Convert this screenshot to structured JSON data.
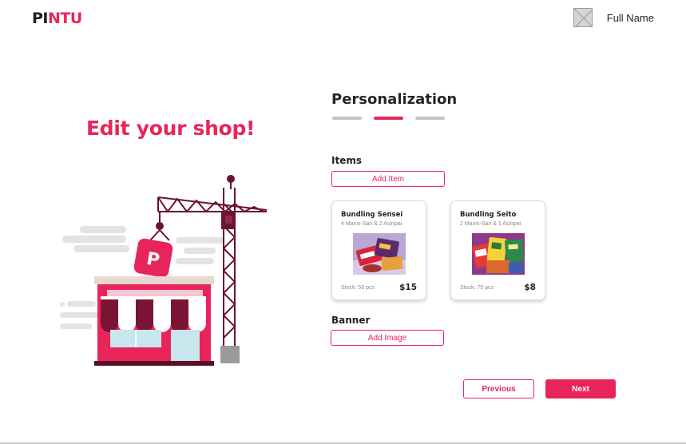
{
  "header": {
    "logo_part1": "PI",
    "logo_part2": "NTU",
    "user_name": "Full Name",
    "avatar_icon": "image-placeholder-icon"
  },
  "hero": {
    "headline": "Edit your shop!",
    "illustration_icon": "shop-under-construction-illustration",
    "sign_letter": "P"
  },
  "form": {
    "title": "Personalization",
    "steps_total": 3,
    "active_step": 2,
    "items_label": "Items",
    "add_item_label": "Add Item",
    "banner_label": "Banner",
    "add_image_label": "Add Image"
  },
  "products": [
    {
      "name": "Bundling Sensei",
      "description": "4 Manis-San & 2 Asinpai",
      "stock": "Stock: 50 pcs",
      "price": "$15"
    },
    {
      "name": "Bundling Seito",
      "description": "2 Manis-San & 1 Asinpai",
      "stock": "Stock: 75 pcs",
      "price": "$8"
    }
  ],
  "actions": {
    "previous_label": "Previous",
    "next_label": "Next"
  },
  "colors": {
    "accent": "#e8255a",
    "crane": "#6b1330",
    "step_inactive": "#c4c4c4"
  }
}
